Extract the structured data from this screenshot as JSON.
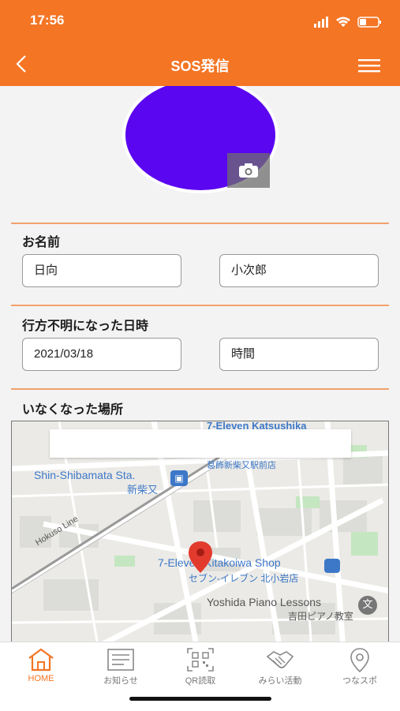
{
  "status_bar": {
    "time": "17:56"
  },
  "header": {
    "title": "SOS発信"
  },
  "form": {
    "name_label": "お名前",
    "last_name": "日向",
    "first_name": "小次郎",
    "datetime_label": "行方不明になった日時",
    "date": "2021/03/18",
    "time_placeholder": "時間",
    "place_label": "いなくなった場所"
  },
  "map": {
    "labels": {
      "seven_top": "7-Eleven Katsushika",
      "station_jp_shop": "葛飾新柴又駅前店",
      "station_en": "Shin-Shibamata Sta.",
      "station_jp": "新柴又",
      "line": "Hokuso Line",
      "seven_main": "7-Eleven Kitakoiwa Shop",
      "seven_main_jp": "セブン-イレブン 北小岩店",
      "piano": "Yoshida Piano Lessons",
      "piano_jp": "吉田ピアノ教室"
    }
  },
  "tabs": [
    {
      "label": "HOME",
      "icon": "home-icon",
      "active": true
    },
    {
      "label": "お知らせ",
      "icon": "news-icon",
      "active": false
    },
    {
      "label": "QR読取",
      "icon": "qr-icon",
      "active": false
    },
    {
      "label": "みらい活動",
      "icon": "handshake-icon",
      "active": false
    },
    {
      "label": "つなスポ",
      "icon": "location-pin-icon",
      "active": false
    }
  ],
  "colors": {
    "brand": "#f47524",
    "avatar": "#5b06f0"
  }
}
